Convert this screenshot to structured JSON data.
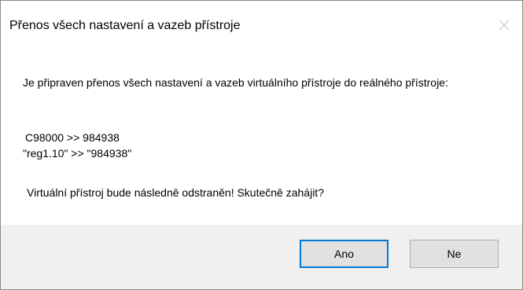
{
  "dialog": {
    "title": "Přenos všech nastavení a vazeb přístroje",
    "close_icon": "close-icon",
    "message": {
      "intro": "Je připraven přenos všech nastavení a vazeb virtuálního přístroje do reálného přístroje:",
      "mappings": [
        "C98000 >> 984938",
        "\"reg1.10\" >> \"984938\""
      ],
      "question": "Virtuální přístroj bude následně odstraněn! Skutečně zahájit?"
    },
    "buttons": {
      "yes_label": "Ano",
      "no_label": "Ne"
    }
  },
  "colors": {
    "footer_bg": "#f0f0f0",
    "button_bg": "#e1e1e1",
    "focus_border": "#0078d7"
  }
}
